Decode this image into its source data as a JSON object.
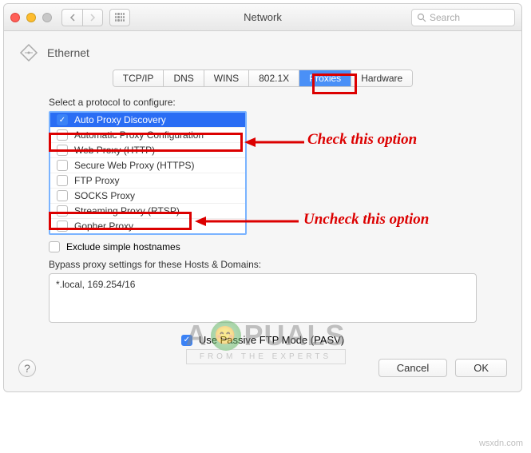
{
  "window": {
    "title": "Network",
    "search_placeholder": "Search"
  },
  "breadcrumb": {
    "label": "Ethernet"
  },
  "tabs": [
    {
      "label": "TCP/IP",
      "active": false
    },
    {
      "label": "DNS",
      "active": false
    },
    {
      "label": "WINS",
      "active": false
    },
    {
      "label": "802.1X",
      "active": false
    },
    {
      "label": "Proxies",
      "active": true
    },
    {
      "label": "Hardware",
      "active": false
    }
  ],
  "protocols": {
    "label": "Select a protocol to configure:",
    "items": [
      {
        "label": "Auto Proxy Discovery",
        "checked": true,
        "selected": true
      },
      {
        "label": "Automatic Proxy Configuration",
        "checked": false,
        "selected": false
      },
      {
        "label": "Web Proxy (HTTP)",
        "checked": false,
        "selected": false
      },
      {
        "label": "Secure Web Proxy (HTTPS)",
        "checked": false,
        "selected": false
      },
      {
        "label": "FTP Proxy",
        "checked": false,
        "selected": false
      },
      {
        "label": "SOCKS Proxy",
        "checked": false,
        "selected": false
      },
      {
        "label": "Streaming Proxy (RTSP)",
        "checked": false,
        "selected": false
      },
      {
        "label": "Gopher Proxy",
        "checked": false,
        "selected": false
      }
    ]
  },
  "exclude": {
    "label": "Exclude simple hostnames",
    "checked": false
  },
  "bypass": {
    "label": "Bypass proxy settings for these Hosts & Domains:",
    "value": "*.local, 169.254/16"
  },
  "pasv": {
    "label": "Use Passive FTP Mode (PASV)",
    "checked": true
  },
  "buttons": {
    "cancel": "Cancel",
    "ok": "OK"
  },
  "annotations": {
    "check": "Check this option",
    "uncheck": "Uncheck this option"
  },
  "watermark": {
    "brand": "APPUALS",
    "tagline": "FROM THE EXPERTS",
    "logo_part_a": "A",
    "logo_part_b": "PUALS"
  },
  "source": "wsxdn.com"
}
